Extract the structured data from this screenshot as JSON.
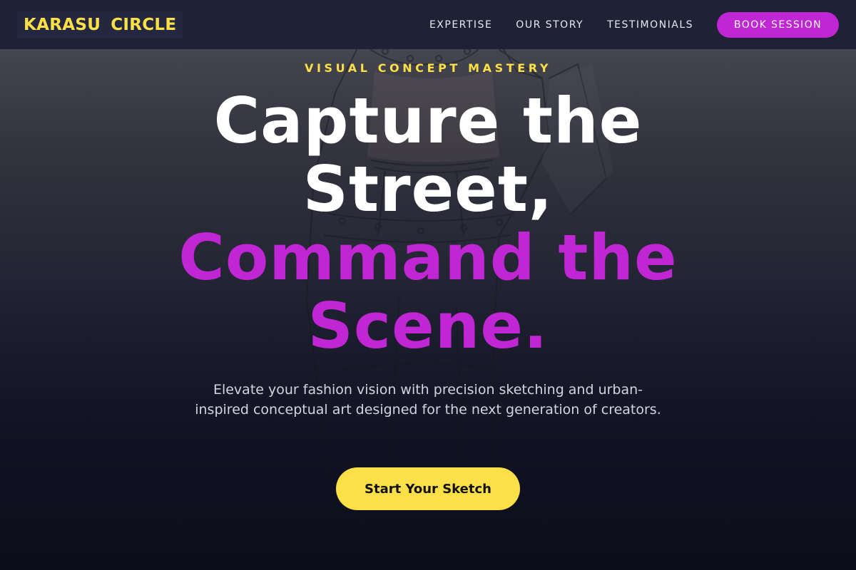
{
  "nav": {
    "logo_word1": "KARASU",
    "logo_word2": "CIRCLE",
    "links": [
      {
        "label": "EXPERTISE"
      },
      {
        "label": "OUR STORY"
      },
      {
        "label": "TESTIMONIALS"
      }
    ],
    "book_label": "BOOK SESSION"
  },
  "hero": {
    "eyebrow": "VISUAL CONCEPT MASTERY",
    "headline_line1": "Capture the Street,",
    "headline_accent": "Command the Scene.",
    "subtext": "Elevate your fashion vision with precision sketching and urban-inspired conceptual art designed for the next generation of creators.",
    "cta_label": "Start Your Sketch"
  },
  "colors": {
    "brand_yellow": "#fde047",
    "brand_magenta": "#c026d3",
    "nav_bg": "#1f2235"
  }
}
